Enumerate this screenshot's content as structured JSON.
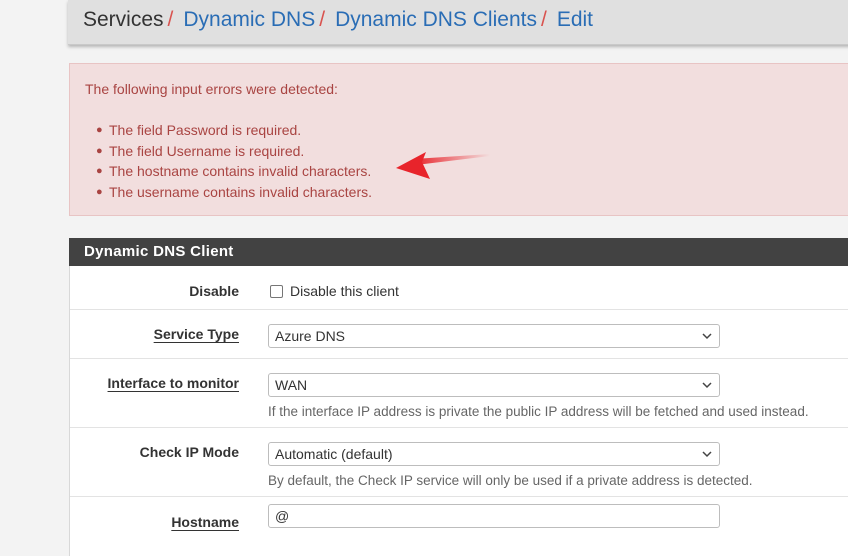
{
  "breadcrumb": {
    "items": [
      "Services",
      "Dynamic DNS",
      "Dynamic DNS Clients",
      "Edit"
    ],
    "separator": "/"
  },
  "alert": {
    "heading": "The following input errors were detected:",
    "errors": [
      "The field Password is required.",
      "The field Username is required.",
      "The hostname contains invalid characters.",
      "The username contains invalid characters."
    ]
  },
  "panel": {
    "title": "Dynamic DNS Client",
    "disable": {
      "label": "Disable",
      "checkbox_label": "Disable this client",
      "checked": false
    },
    "service_type": {
      "label": "Service Type",
      "value": "Azure DNS"
    },
    "interface": {
      "label": "Interface to monitor",
      "value": "WAN",
      "help": "If the interface IP address is private the public IP address will be fetched and used instead."
    },
    "check_ip_mode": {
      "label": "Check IP Mode",
      "value": "Automatic (default)",
      "help": "By default, the Check IP service will only be used if a private address is detected."
    },
    "hostname": {
      "label": "Hostname",
      "value": "@"
    }
  },
  "colors": {
    "link": "#2a6db5",
    "separator": "#d9534f",
    "alert_bg": "#f2dede",
    "alert_text": "#a94442",
    "panel_header_bg": "#424242",
    "annotation_arrow": "#e8242b"
  },
  "icons": {
    "select_indicator": "chevron-down-icon",
    "bullet": "bullet",
    "annotation": "red-arrow"
  }
}
